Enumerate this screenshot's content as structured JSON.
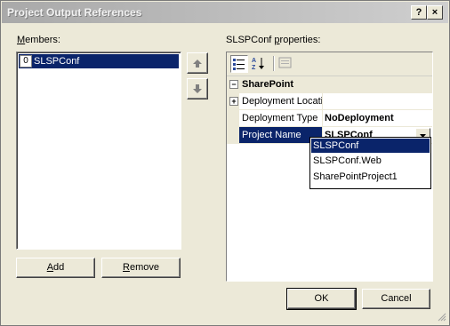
{
  "window": {
    "title": "Project Output References",
    "help_label": "?",
    "close_label": "×"
  },
  "members": {
    "label_pre": "",
    "label_ul": "M",
    "label_post": "embers:",
    "items": [
      {
        "index": "0",
        "name": "SLSPConf"
      }
    ],
    "move_up_icon": "arrow-up-icon",
    "move_down_icon": "arrow-down-icon",
    "add_pre": "",
    "add_ul": "A",
    "add_post": "dd",
    "remove_pre": "",
    "remove_ul": "R",
    "remove_post": "emove"
  },
  "properties": {
    "label_pre": "SLSPConf ",
    "label_ul": "p",
    "label_post": "roperties:",
    "toolbar": {
      "categorized_icon": "categorized-icon",
      "alphabetical_icon": "alphabetical-sort-icon",
      "property_pages_icon": "property-pages-icon"
    },
    "category": {
      "expander": "−",
      "name": "SharePoint"
    },
    "rows": [
      {
        "expander": "+",
        "name": "Deployment Locati",
        "value": ""
      },
      {
        "expander": "",
        "name": "Deployment Type",
        "value": "NoDeployment"
      },
      {
        "expander": "",
        "name": "Project Name",
        "value": "SLSPConf"
      }
    ],
    "dropdown_options": [
      "SLSPConf",
      "SLSPConf.Web",
      "SharePointProject1"
    ],
    "selected_option": "SLSPConf"
  },
  "buttons": {
    "ok": "OK",
    "cancel": "Cancel"
  }
}
